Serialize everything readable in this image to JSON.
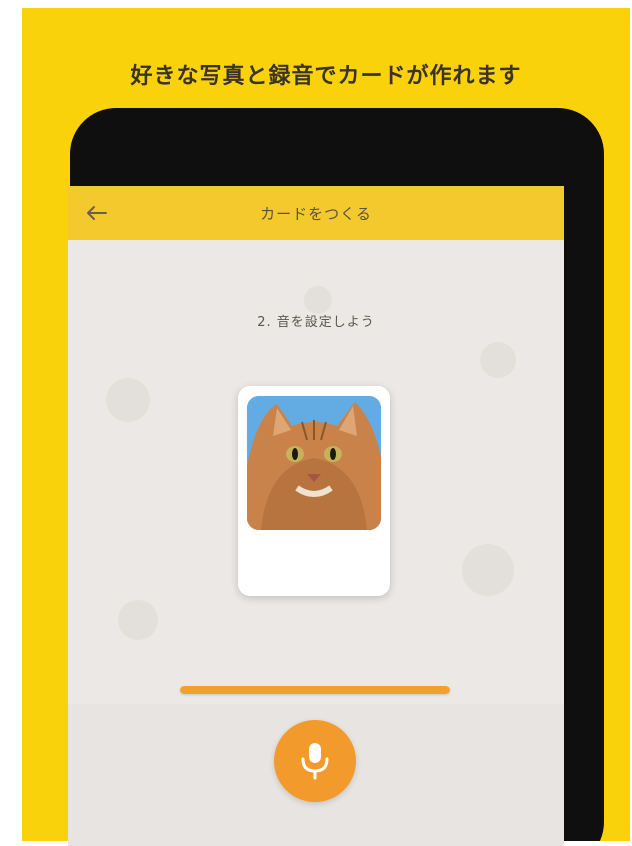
{
  "promo": {
    "headline": "好きな写真と録音でカードが作れます",
    "background_color": "#f9d20c"
  },
  "app_bar": {
    "back_icon": "arrow-left-icon",
    "title": "カードをつくる",
    "color": "#f4c92e"
  },
  "step": {
    "label": "2. 音を設定しよう"
  },
  "card": {
    "photo": "orange-tabby-cat-photo"
  },
  "recording": {
    "progress": 1.0,
    "progress_color": "#f0a12a",
    "mic_icon": "microphone-icon",
    "mic_color": "#f29a2b"
  }
}
